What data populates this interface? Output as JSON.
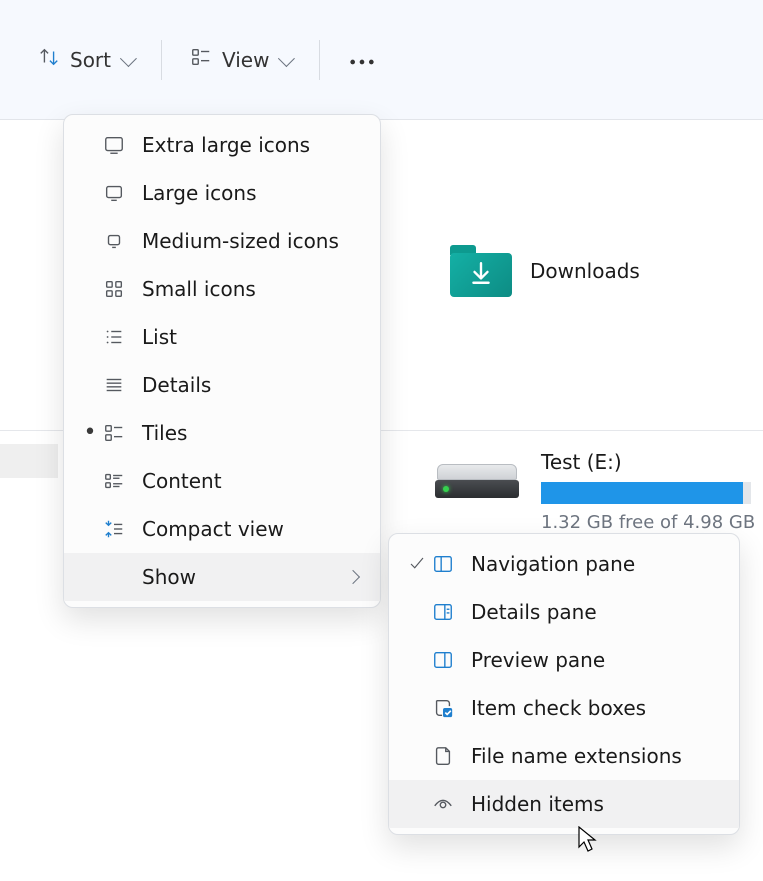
{
  "toolbar": {
    "sort_label": "Sort",
    "view_label": "View"
  },
  "view_menu": {
    "extra_large": "Extra large icons",
    "large": "Large icons",
    "medium": "Medium-sized icons",
    "small": "Small icons",
    "list": "List",
    "details": "Details",
    "tiles": "Tiles",
    "content": "Content",
    "compact": "Compact view",
    "show": "Show"
  },
  "show_submenu": {
    "navigation_pane": "Navigation pane",
    "details_pane": "Details pane",
    "preview_pane": "Preview pane",
    "item_check_boxes": "Item check boxes",
    "file_name_extensions": "File name extensions",
    "hidden_items": "Hidden items"
  },
  "tiles": {
    "downloads_label": "Downloads"
  },
  "drive": {
    "name": "Test (E:)",
    "free_text": "1.32 GB free of 4.98 GB",
    "used_percent": 96
  }
}
